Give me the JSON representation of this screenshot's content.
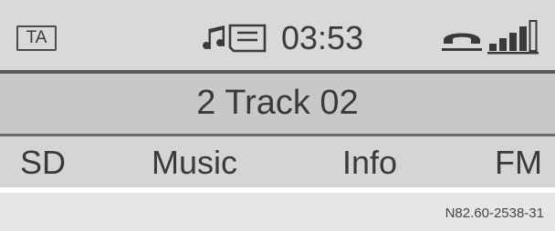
{
  "status": {
    "ta_label": "TA",
    "time": "03:53",
    "media_icon": "sd-card-music-icon",
    "phone_icon": "phone-handset-icon",
    "signal_icon": "signal-strength-icon",
    "signal_level": "4 of 5 bars"
  },
  "track": {
    "title": "2 Track 02"
  },
  "softkeys": {
    "sd": "SD",
    "music": "Music",
    "info": "Info",
    "fm": "FM"
  },
  "footer": {
    "reference": "N82.60-2538-31"
  },
  "colors": {
    "status_bg": "#d9d9d9",
    "track_bg": "#c8c8c8",
    "softkey_bg": "#d5d5d5",
    "text": "#3a3a3a"
  }
}
